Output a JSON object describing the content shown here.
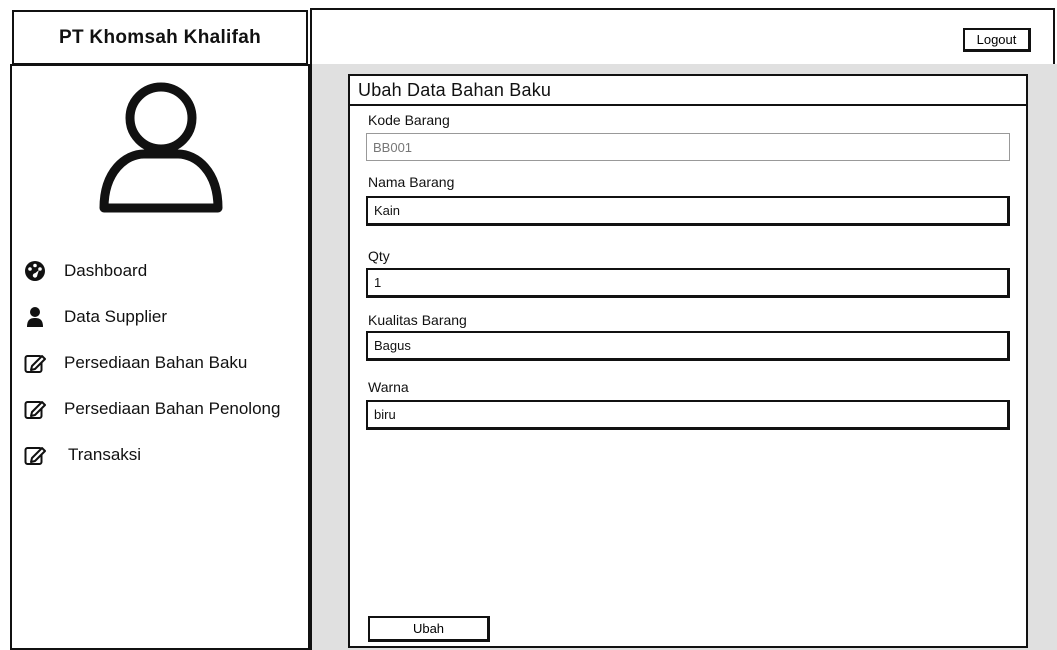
{
  "brand": {
    "title": "PT Khomsah Khalifah"
  },
  "topbar": {
    "logout_label": "Logout"
  },
  "sidebar": {
    "items": [
      {
        "label": "Dashboard",
        "icon": "dashboard-icon"
      },
      {
        "label": "Data Supplier",
        "icon": "user-icon"
      },
      {
        "label": "Persediaan Bahan Baku",
        "icon": "edit-icon"
      },
      {
        "label": "Persediaan Bahan Penolong",
        "icon": "edit-icon"
      },
      {
        "label": "Transaksi",
        "icon": "edit-icon"
      }
    ]
  },
  "form": {
    "title": "Ubah Data Bahan Baku",
    "fields": [
      {
        "label": "Kode Barang",
        "value": "BB001",
        "disabled": true
      },
      {
        "label": "Nama Barang",
        "value": "Kain",
        "disabled": false
      },
      {
        "label": "Qty",
        "value": "1",
        "disabled": false
      },
      {
        "label": "Kualitas Barang",
        "value": "Bagus",
        "disabled": false
      },
      {
        "label": "Warna",
        "value": "biru",
        "disabled": false
      }
    ],
    "submit_label": "Ubah"
  }
}
